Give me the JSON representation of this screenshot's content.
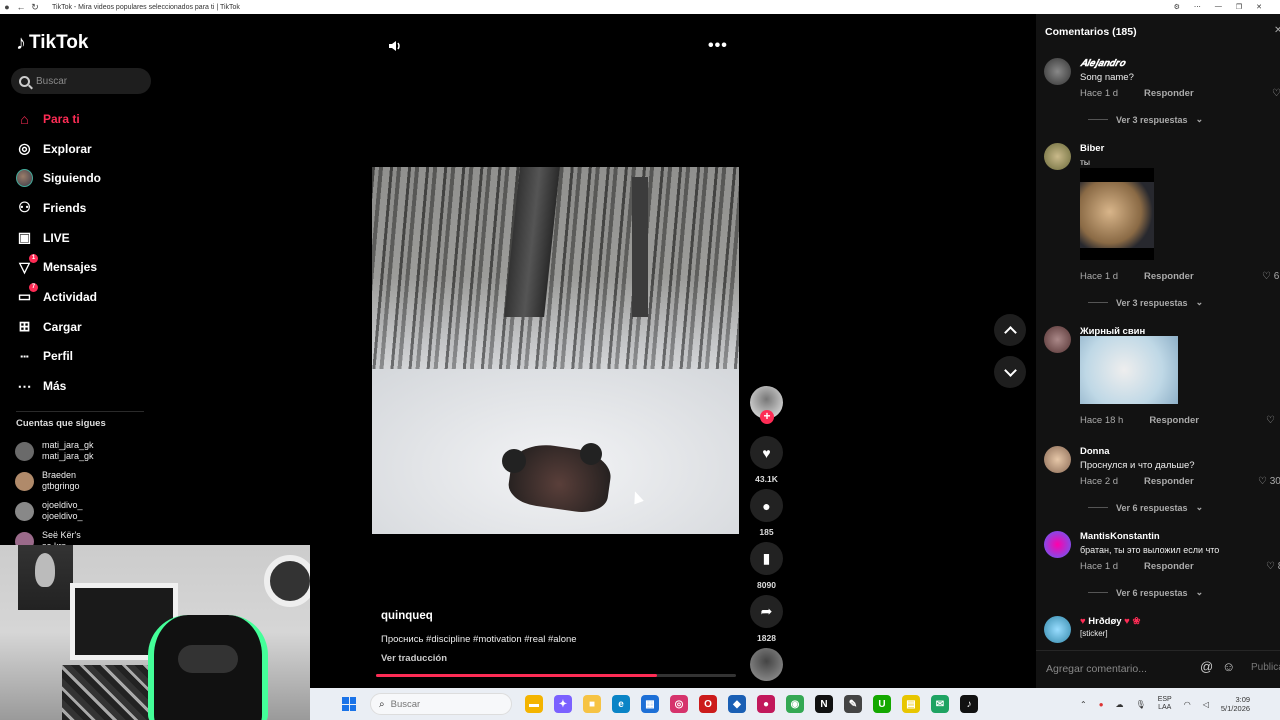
{
  "browser": {
    "title": "TikTok - Mira videos populares seleccionados para ti | TikTok"
  },
  "sidebar": {
    "logo": "TikTok",
    "search_placeholder": "Buscar",
    "nav": [
      {
        "label": "Para ti",
        "icon": "home-icon",
        "active": true
      },
      {
        "label": "Explorar",
        "icon": "compass-icon"
      },
      {
        "label": "Siguiendo",
        "icon": "following-avatar-icon"
      },
      {
        "label": "Friends",
        "icon": "friends-icon"
      },
      {
        "label": "LIVE",
        "icon": "live-icon"
      },
      {
        "label": "Mensajes",
        "icon": "messages-icon",
        "badge": "1"
      },
      {
        "label": "Actividad",
        "icon": "activity-icon",
        "badge": "7"
      },
      {
        "label": "Cargar",
        "icon": "upload-icon"
      },
      {
        "label": "Perfil",
        "icon": "profile-icon"
      },
      {
        "label": "Más",
        "icon": "more-icon"
      }
    ],
    "following_header": "Cuentas que sigues",
    "following": [
      {
        "name": "mati_jara_gk",
        "handle": "mati_jara_gk"
      },
      {
        "name": "Braeden",
        "handle": "gtbgringo"
      },
      {
        "name": "ojoeldivo_",
        "handle": "ojoeldivo_"
      },
      {
        "name": "Seë Kër's",
        "handle": "se.krs"
      }
    ]
  },
  "video": {
    "author": "quinqueq",
    "caption": "Проснись #discipline #motivation #real #alone",
    "translate_label": "Ver traducción",
    "progress": 0.78,
    "actions": {
      "likes": "43.1K",
      "comments": "185",
      "saves": "8090",
      "shares": "1828"
    }
  },
  "comments_panel": {
    "title": "Comentarios (185)",
    "comments": [
      {
        "user": "𝑨𝒍𝒆𝒋𝒂𝒏𝒅𝒓𝒐",
        "text": "Song name?",
        "time": "Hace 1 d",
        "reply": "Responder",
        "replies": "Ver 3 respuestas",
        "likes": ""
      },
      {
        "user": "Biber",
        "text": "ты",
        "time": "Hace 1 d",
        "reply": "Responder",
        "replies": "Ver 3 respuestas",
        "likes": "6"
      },
      {
        "user": "Жирный свин",
        "text": "",
        "time": "Hace 18 h",
        "reply": "Responder",
        "likes": ""
      },
      {
        "user": "Donna",
        "text": "Проснулся и что дальше?",
        "time": "Hace 2 d",
        "reply": "Responder",
        "replies": "Ver 6 respuestas",
        "likes": "30"
      },
      {
        "user": "MantisKonstantin",
        "text": "братан, ты это выложил если что",
        "time": "Hace 1 d",
        "reply": "Responder",
        "replies": "Ver 6 respuestas",
        "likes": "8"
      },
      {
        "user": "Hrðdøy",
        "text": "[sticker]"
      }
    ],
    "input_placeholder": "Agregar comentario...",
    "publish_label": "Publicar"
  },
  "taskbar": {
    "search_placeholder": "Buscar",
    "lang_top": "ESP",
    "lang_bottom": "LAA",
    "time": "3:09",
    "date": "5/1/2026",
    "apps": [
      {
        "icon": "file-explorer-icon",
        "color": "#f4b400",
        "glyph": "▬"
      },
      {
        "icon": "copilot-icon",
        "color": "#7b61ff",
        "glyph": "✦"
      },
      {
        "icon": "folder-icon",
        "color": "#f6c344",
        "glyph": "■"
      },
      {
        "icon": "edge-icon",
        "color": "#0a84c6",
        "glyph": "e"
      },
      {
        "icon": "store-icon",
        "color": "#1d6fd6",
        "glyph": "▦"
      },
      {
        "icon": "instagram-icon",
        "color": "#d6336c",
        "glyph": "◎"
      },
      {
        "icon": "opera-icon",
        "color": "#cc1b1b",
        "glyph": "O"
      },
      {
        "icon": "defender-icon",
        "color": "#1a5fb4",
        "glyph": "◆"
      },
      {
        "icon": "recorder-icon",
        "color": "#c2185b",
        "glyph": "●"
      },
      {
        "icon": "chrome-icon",
        "color": "#34a853",
        "glyph": "◉"
      },
      {
        "icon": "netflix-icon",
        "color": "#111",
        "glyph": "N"
      },
      {
        "icon": "notes-icon",
        "color": "#444",
        "glyph": "✎"
      },
      {
        "icon": "upwork-icon",
        "color": "#14a800",
        "glyph": "U"
      },
      {
        "icon": "sticky-notes-icon",
        "color": "#e8c600",
        "glyph": "▤"
      },
      {
        "icon": "chat-icon",
        "color": "#1ea362",
        "glyph": "✉"
      },
      {
        "icon": "tiktok-icon",
        "color": "#111",
        "glyph": "♪"
      }
    ]
  },
  "colors": {
    "accent": "#fe2c55",
    "background": "#000000",
    "panel": "#121212"
  }
}
